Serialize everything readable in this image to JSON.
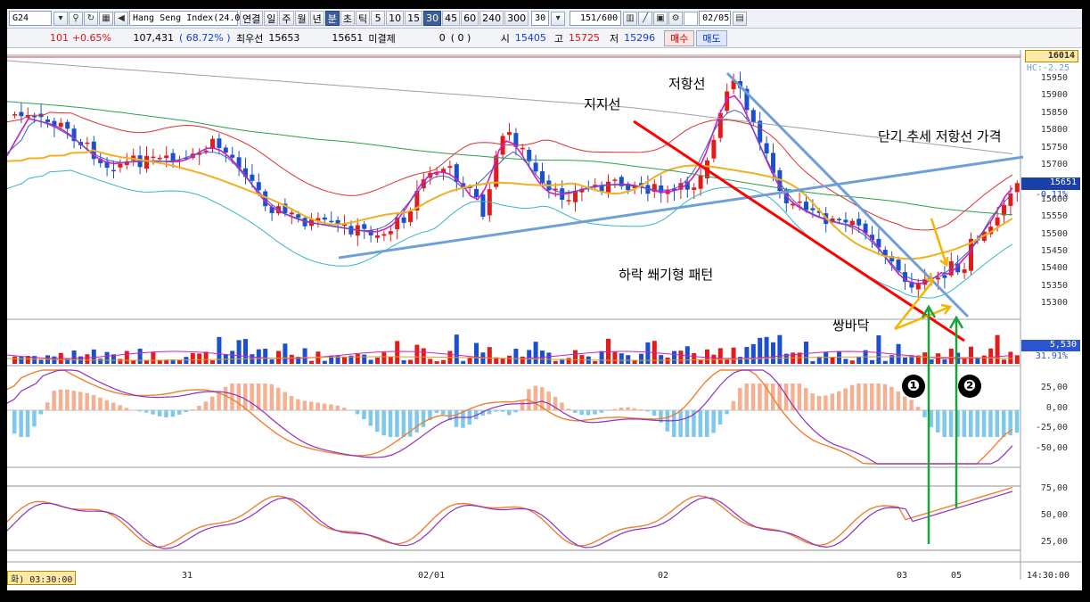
{
  "toolbar": {
    "code": "G24",
    "index_name": "Hang Seng Index(24.0",
    "connect": "연결",
    "periods": [
      "일",
      "주",
      "월",
      "년",
      "분",
      "초",
      "틱"
    ],
    "active_period": "분",
    "intervals": [
      "5",
      "10",
      "15",
      "30",
      "45",
      "60",
      "240",
      "300"
    ],
    "active_interval": "30",
    "interval_select": "30",
    "count": "151",
    "count_total": "/600",
    "date": "02/05"
  },
  "quote": {
    "change": "101",
    "change_pct": "+0.65%",
    "volume": "107,431",
    "ratio": "( 68.72% )",
    "best_bid_label": "최우선",
    "best_bid": "15653",
    "price": "15651",
    "open_interest_label": "미결제",
    "open_interest": "0",
    "oi_change": "( 0 )",
    "open_label": "시",
    "open": "15405",
    "high_label": "고",
    "high": "15725",
    "low_label": "저",
    "low": "15296",
    "buy": "매수",
    "sell": "매도"
  },
  "annotations": {
    "support": "지지선",
    "resistance": "저항선",
    "short_term_resistance": "단기 추세 저항선 가격",
    "falling_wedge": "하락 쐐기형 패턴",
    "double_bottom": "쌍바닥",
    "badge1": "❶",
    "badge2": "❷"
  },
  "price_axis": {
    "top_box": "16014",
    "hc_label": "HC:-2.25",
    "ticks": [
      "15950",
      "15900",
      "15850",
      "15800",
      "15750",
      "15700",
      "15650",
      "15600",
      "15550",
      "15500",
      "15450",
      "15400",
      "15350",
      "15300"
    ],
    "current": "15651",
    "current_pct": "-0.11%"
  },
  "volume_axis": {
    "value": "5,530",
    "pct": "31.91%"
  },
  "macd_axis": {
    "ticks": [
      "25,00",
      "0,00",
      "-25,00",
      "-50,00"
    ]
  },
  "stoch_axis": {
    "ticks": [
      "75,00",
      "50,00",
      "25,00"
    ]
  },
  "date_axis": {
    "left_label": "화) 03:30:00",
    "labels": [
      "31",
      "02/01",
      "02",
      "03",
      "05"
    ],
    "right_label": "14:30:00"
  },
  "colors": {
    "bull": "#e31b1b",
    "bear": "#1a4fd0",
    "support_line": "#ff0000",
    "resistance_line": "#6f9fd8",
    "signal_arrow": "#1aa33a",
    "highlight_arrow": "#f5b400"
  }
}
